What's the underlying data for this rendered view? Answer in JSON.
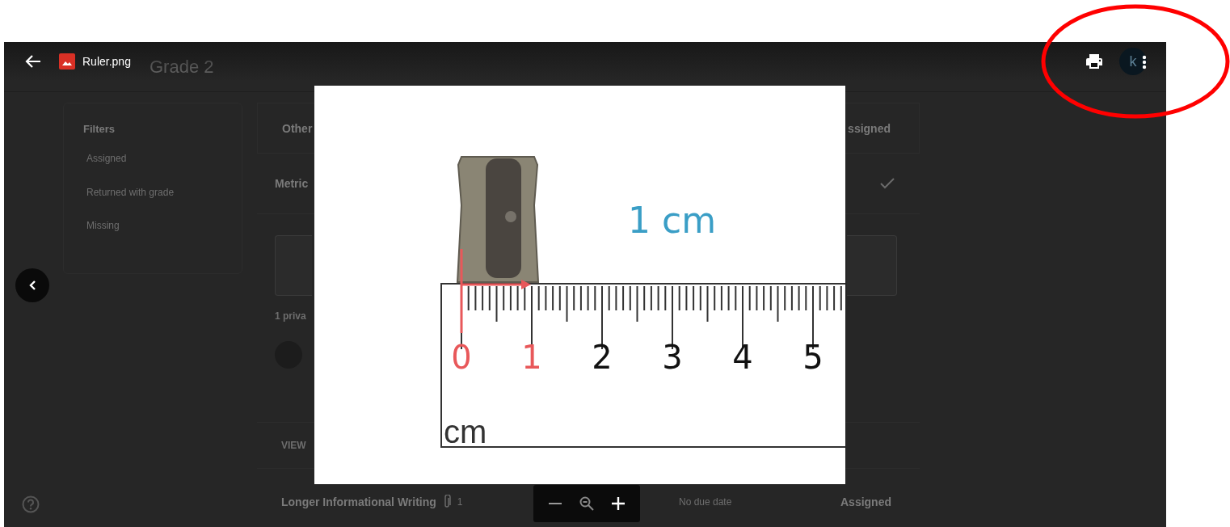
{
  "background": {
    "header_title": "Grade 2",
    "filters": {
      "title": "Filters",
      "items": [
        "Assigned",
        "Returned with grade",
        "Missing"
      ]
    },
    "rows": [
      {
        "kind": "heading",
        "title": "Other",
        "status": "ssigned"
      },
      {
        "kind": "done",
        "title": "Metric"
      },
      {
        "kind": "attachment"
      },
      {
        "kind": "comments",
        "title": "1 priva"
      },
      {
        "kind": "action",
        "title": "VIEW"
      },
      {
        "kind": "assignment",
        "title": "Longer Informational Writing",
        "attachments": "1",
        "due": "No due date",
        "status": "Assigned"
      }
    ]
  },
  "viewer": {
    "file_name": "Ruler.png",
    "avatar_initial": "k",
    "image": {
      "caption": "1 cm",
      "unit": "cm",
      "ruler_labels": [
        {
          "text": "0",
          "color": "#e8585a"
        },
        {
          "text": "1",
          "color": "#e8585a"
        },
        {
          "text": "2",
          "color": "#111111"
        },
        {
          "text": "3",
          "color": "#111111"
        },
        {
          "text": "4",
          "color": "#111111"
        },
        {
          "text": "5",
          "color": "#111111"
        }
      ]
    }
  }
}
